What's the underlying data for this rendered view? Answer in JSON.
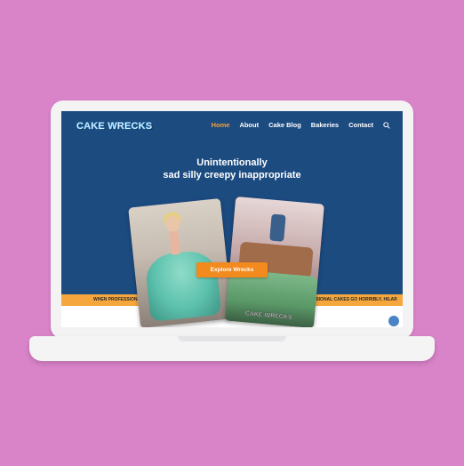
{
  "site": {
    "logo_text": "CAKE WRECKS"
  },
  "nav": {
    "items": [
      {
        "label": "Home",
        "active": true
      },
      {
        "label": "About",
        "active": false
      },
      {
        "label": "Cake Blog",
        "active": false
      },
      {
        "label": "Bakeries",
        "active": false
      },
      {
        "label": "Contact",
        "active": false
      }
    ],
    "search_icon": "search-icon"
  },
  "hero": {
    "line1": "Unintentionally",
    "line2": "sad silly creepy inappropriate",
    "button_label": "Explore Wrecks"
  },
  "banner": {
    "text_left": "WHEN PROFESSIONAL CAK",
    "text_right": "SSIONAL CAKES GO HORRIBLY, HILAR"
  },
  "photos": {
    "right_caption": "CAKE WRECKS"
  },
  "colors": {
    "background": "#d983c9",
    "header_blue": "#1c4b80",
    "accent_orange": "#f28a1e",
    "banner_orange": "#f5a73d"
  }
}
